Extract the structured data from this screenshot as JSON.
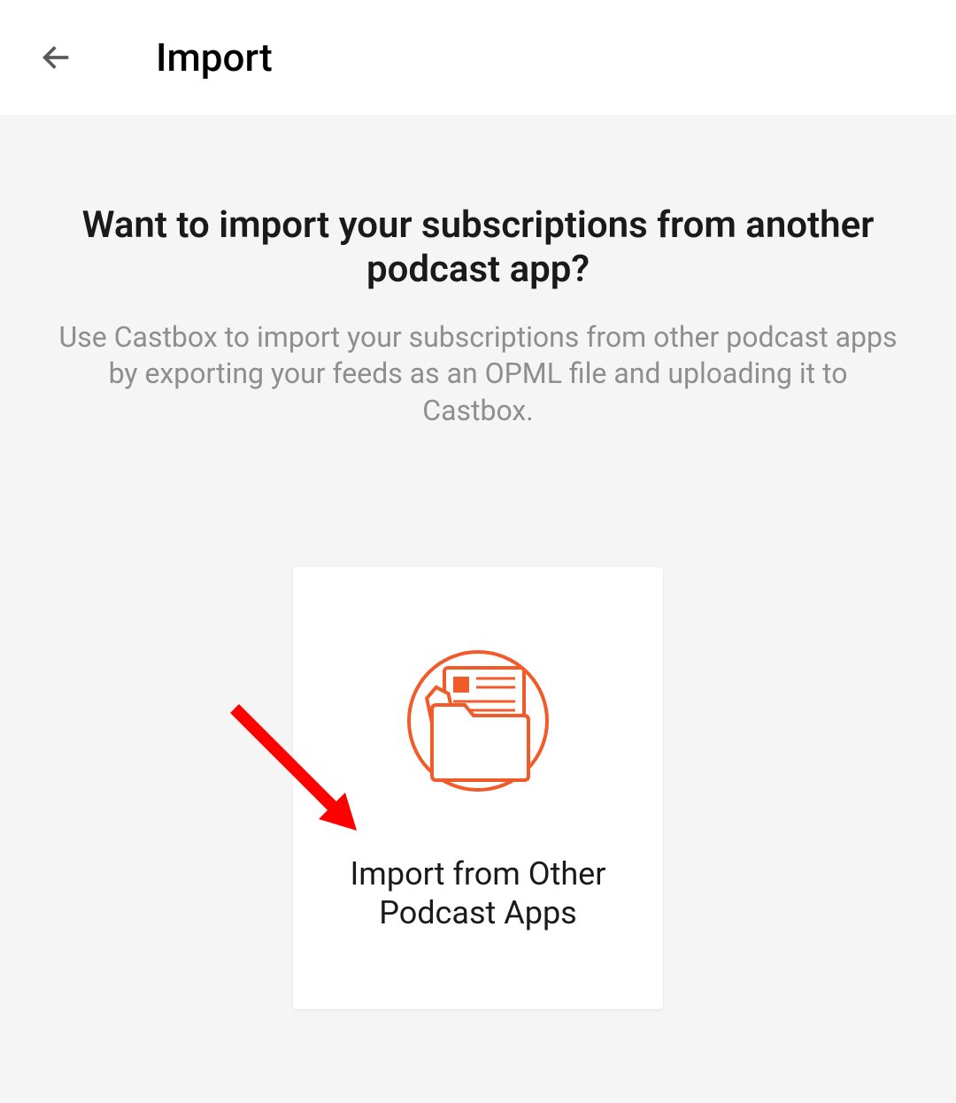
{
  "header": {
    "title": "Import"
  },
  "content": {
    "heading": "Want to import your subscriptions from another podcast app?",
    "subtext": "Use Castbox to import your subscriptions from other podcast apps by exporting your feeds as an OPML file and uploading it to Castbox."
  },
  "card": {
    "label": "Import from Other Podcast Apps"
  },
  "colors": {
    "accent": "#f15a29",
    "pointer": "#ff0000"
  }
}
